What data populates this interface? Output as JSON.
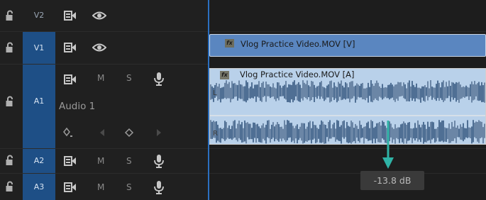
{
  "tracks": [
    {
      "id": "V2",
      "label": "V2",
      "targeted": false,
      "locked": true,
      "type": "video"
    },
    {
      "id": "V1",
      "label": "V1",
      "targeted": true,
      "locked": true,
      "type": "video"
    },
    {
      "id": "A1",
      "label": "A1",
      "targeted": true,
      "locked": true,
      "type": "audio",
      "name": "Audio 1",
      "expanded": true
    },
    {
      "id": "A2",
      "label": "A2",
      "targeted": true,
      "locked": true,
      "type": "audio"
    },
    {
      "id": "A3",
      "label": "A3",
      "targeted": true,
      "locked": true,
      "type": "audio"
    }
  ],
  "audio_controls": {
    "mute": "M",
    "solo": "S"
  },
  "clips": {
    "video": {
      "fx": "fx",
      "name": "Vlog Practice Video.MOV [V]"
    },
    "audio": {
      "fx": "fx",
      "name": "Vlog Practice Video.MOV [A]",
      "channel_left": "L",
      "channel_right": "R"
    }
  },
  "tooltip": {
    "text": "-13.8 dB"
  },
  "colors": {
    "target_active": "#1e4f86",
    "video_clip": "#5a86c0",
    "audio_clip": "#b9d1ea",
    "playhead": "#2b6fc0",
    "arrow": "#2fb3a6"
  }
}
